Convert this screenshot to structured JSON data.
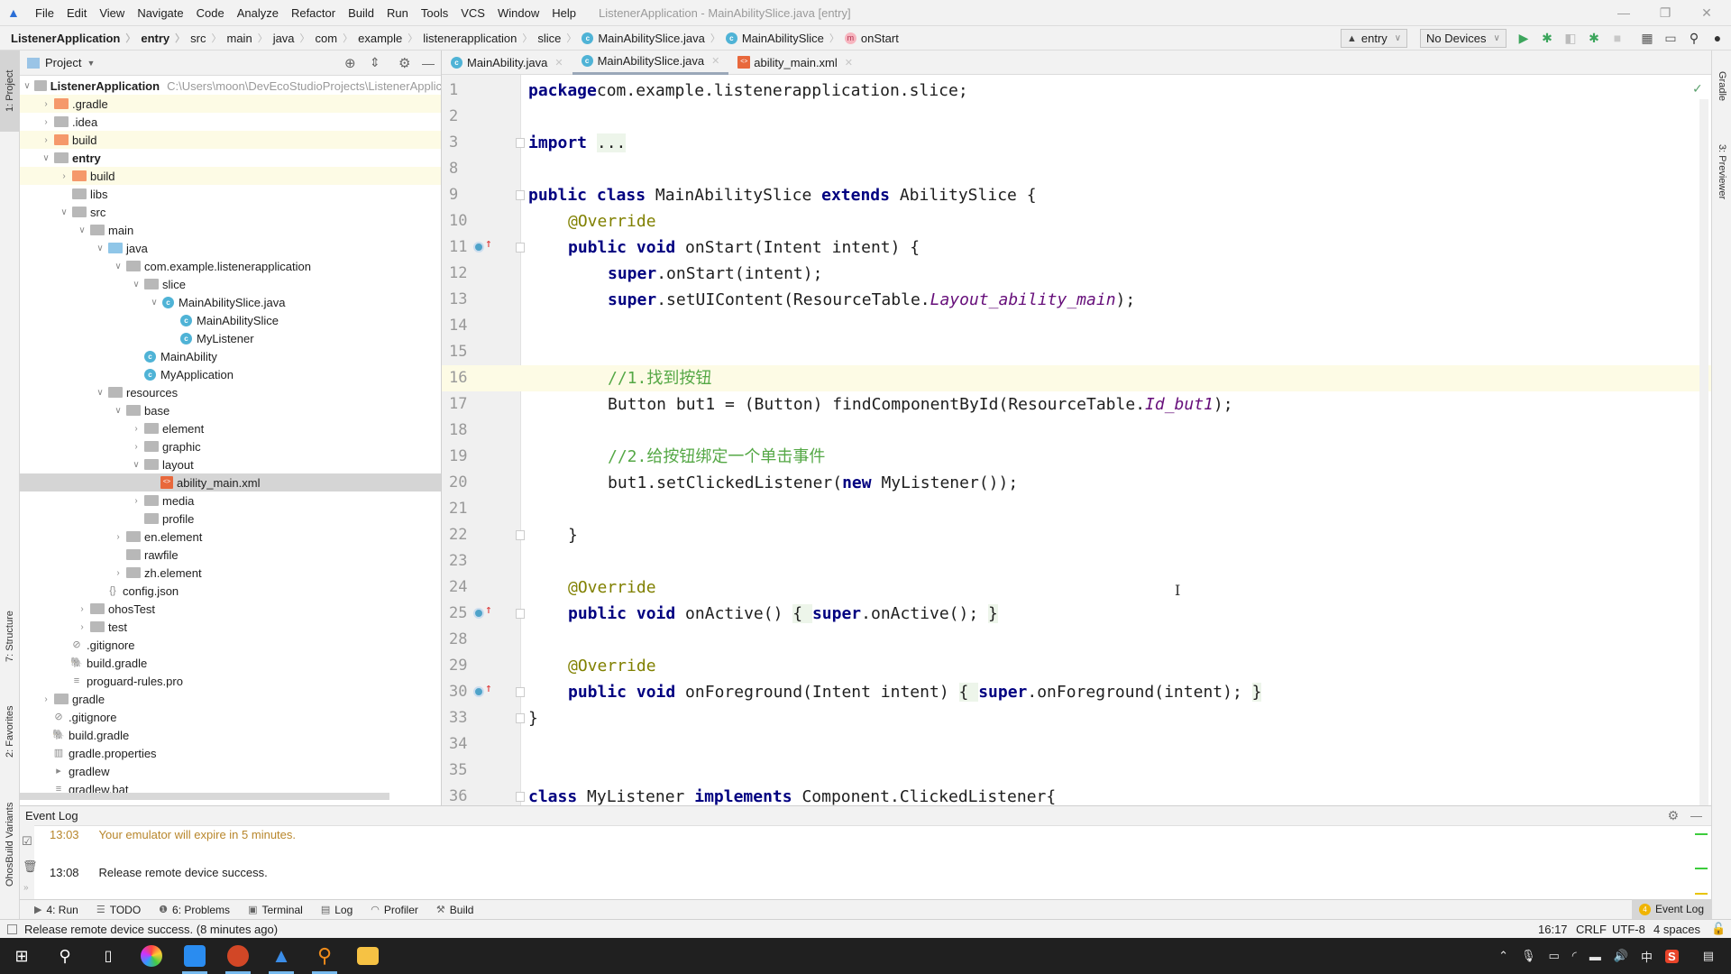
{
  "menubar": {
    "items": [
      "File",
      "Edit",
      "View",
      "Navigate",
      "Code",
      "Analyze",
      "Refactor",
      "Build",
      "Run",
      "Tools",
      "VCS",
      "Window",
      "Help"
    ],
    "window_title": "ListenerApplication - MainAbilitySlice.java [entry]"
  },
  "navbar": {
    "breadcrumbs": [
      "ListenerApplication",
      "entry",
      "src",
      "main",
      "java",
      "com",
      "example",
      "listenerapplication",
      "slice",
      "MainAbilitySlice.java",
      "MainAbilitySlice",
      "onStart"
    ],
    "module_select": "entry",
    "device_select": "No Devices"
  },
  "left_stripe": {
    "tabs": [
      "1: Project",
      "7: Structure",
      "2: Favorites",
      "OhosBuild Variants"
    ]
  },
  "right_stripe": {
    "tabs": [
      "Gradle",
      "3: Previewer"
    ]
  },
  "project": {
    "title": "Project",
    "root": {
      "name": "ListenerApplication",
      "path": "C:\\Users\\moon\\DevEcoStudioProjects\\ListenerApplic"
    },
    "rows": [
      {
        "label": ".gradle",
        "depth": 1,
        "arrow": "right",
        "icon": "folder-orange",
        "hl": true
      },
      {
        "label": ".idea",
        "depth": 1,
        "arrow": "right",
        "icon": "folder-gray"
      },
      {
        "label": "build",
        "depth": 1,
        "arrow": "right",
        "icon": "folder-orange",
        "hl": true
      },
      {
        "label": "entry",
        "depth": 1,
        "arrow": "down",
        "icon": "folder-module",
        "bold": true
      },
      {
        "label": "build",
        "depth": 2,
        "arrow": "right",
        "icon": "folder-orange",
        "hl": true
      },
      {
        "label": "libs",
        "depth": 2,
        "arrow": "",
        "icon": "folder-gray"
      },
      {
        "label": "src",
        "depth": 2,
        "arrow": "down",
        "icon": "folder-gray"
      },
      {
        "label": "main",
        "depth": 3,
        "arrow": "down",
        "icon": "folder-gray"
      },
      {
        "label": "java",
        "depth": 4,
        "arrow": "down",
        "icon": "folder-blue"
      },
      {
        "label": "com.example.listenerapplication",
        "depth": 5,
        "arrow": "down",
        "icon": "folder-gray"
      },
      {
        "label": "slice",
        "depth": 6,
        "arrow": "down",
        "icon": "folder-gray"
      },
      {
        "label": "MainAbilitySlice.java",
        "depth": 7,
        "arrow": "down",
        "icon": "class"
      },
      {
        "label": "MainAbilitySlice",
        "depth": 8,
        "arrow": "",
        "icon": "class"
      },
      {
        "label": "MyListener",
        "depth": 8,
        "arrow": "",
        "icon": "class"
      },
      {
        "label": "MainAbility",
        "depth": 6,
        "arrow": "",
        "icon": "class"
      },
      {
        "label": "MyApplication",
        "depth": 6,
        "arrow": "",
        "icon": "class"
      },
      {
        "label": "resources",
        "depth": 4,
        "arrow": "down",
        "icon": "folder-res"
      },
      {
        "label": "base",
        "depth": 5,
        "arrow": "down",
        "icon": "folder-gray"
      },
      {
        "label": "element",
        "depth": 6,
        "arrow": "right",
        "icon": "folder-gray"
      },
      {
        "label": "graphic",
        "depth": 6,
        "arrow": "right",
        "icon": "folder-gray"
      },
      {
        "label": "layout",
        "depth": 6,
        "arrow": "down",
        "icon": "folder-gray"
      },
      {
        "label": "ability_main.xml",
        "depth": 7,
        "arrow": "",
        "icon": "xml",
        "sel": true
      },
      {
        "label": "media",
        "depth": 6,
        "arrow": "right",
        "icon": "folder-gray"
      },
      {
        "label": "profile",
        "depth": 6,
        "arrow": "",
        "icon": "folder-gray"
      },
      {
        "label": "en.element",
        "depth": 5,
        "arrow": "right",
        "icon": "folder-gray"
      },
      {
        "label": "rawfile",
        "depth": 5,
        "arrow": "",
        "icon": "folder-gray"
      },
      {
        "label": "zh.element",
        "depth": 5,
        "arrow": "right",
        "icon": "folder-gray"
      },
      {
        "label": "config.json",
        "depth": 4,
        "arrow": "",
        "icon": "json"
      },
      {
        "label": "ohosTest",
        "depth": 3,
        "arrow": "right",
        "icon": "folder-gray"
      },
      {
        "label": "test",
        "depth": 3,
        "arrow": "right",
        "icon": "folder-gray"
      },
      {
        "label": ".gitignore",
        "depth": 2,
        "arrow": "",
        "icon": "gitignore"
      },
      {
        "label": "build.gradle",
        "depth": 2,
        "arrow": "",
        "icon": "gradle"
      },
      {
        "label": "proguard-rules.pro",
        "depth": 2,
        "arrow": "",
        "icon": "text"
      },
      {
        "label": "gradle",
        "depth": 1,
        "arrow": "right",
        "icon": "folder-gray"
      },
      {
        "label": ".gitignore",
        "depth": 1,
        "arrow": "",
        "icon": "gitignore"
      },
      {
        "label": "build.gradle",
        "depth": 1,
        "arrow": "",
        "icon": "gradle"
      },
      {
        "label": "gradle.properties",
        "depth": 1,
        "arrow": "",
        "icon": "properties"
      },
      {
        "label": "gradlew",
        "depth": 1,
        "arrow": "",
        "icon": "exec"
      },
      {
        "label": "gradlew.bat",
        "depth": 1,
        "arrow": "",
        "icon": "text"
      }
    ]
  },
  "editor": {
    "tabs": [
      {
        "label": "MainAbility.java",
        "icon": "class"
      },
      {
        "label": "MainAbilitySlice.java",
        "icon": "class",
        "active": true
      },
      {
        "label": "ability_main.xml",
        "icon": "xml"
      }
    ],
    "current_line": 16,
    "lines": [
      {
        "n": "1",
        "indent": 0,
        "tokens": [
          [
            "kw",
            "package"
          ],
          [
            "",
            "com.example.listenerapplication.slice;"
          ]
        ]
      },
      {
        "n": "2",
        "indent": 0,
        "tokens": []
      },
      {
        "n": "3",
        "indent": 0,
        "fold": true,
        "tokens": [
          [
            "kw",
            "import"
          ],
          [
            "",
            " "
          ],
          [
            "fb",
            "..."
          ]
        ]
      },
      {
        "n": "8",
        "indent": 0,
        "tokens": []
      },
      {
        "n": "9",
        "indent": 0,
        "fold": true,
        "tokens": [
          [
            "kw",
            "public class"
          ],
          [
            "",
            " MainAbilitySlice "
          ],
          [
            "kw",
            "extends"
          ],
          [
            "",
            " AbilitySlice {"
          ]
        ]
      },
      {
        "n": "10",
        "indent": 1,
        "tokens": [
          [
            "an",
            "@Override"
          ]
        ]
      },
      {
        "n": "11",
        "indent": 1,
        "override": true,
        "fold": true,
        "tokens": [
          [
            "kw",
            "public void"
          ],
          [
            "",
            " onStart(Intent intent) {"
          ]
        ]
      },
      {
        "n": "12",
        "indent": 2,
        "tokens": [
          [
            "kw",
            "super"
          ],
          [
            "",
            ".onStart(intent);"
          ]
        ]
      },
      {
        "n": "13",
        "indent": 2,
        "tokens": [
          [
            "kw",
            "super"
          ],
          [
            "",
            ".setUIContent(ResourceTable."
          ],
          [
            "it",
            "Layout_ability_main"
          ],
          [
            "",
            ");"
          ]
        ]
      },
      {
        "n": "14",
        "indent": 0,
        "tokens": []
      },
      {
        "n": "15",
        "indent": 0,
        "tokens": []
      },
      {
        "n": "16",
        "indent": 2,
        "tokens": [
          [
            "cm",
            "//1.找到按钮"
          ]
        ]
      },
      {
        "n": "17",
        "indent": 2,
        "tokens": [
          [
            "",
            "Button but1 = (Button) findComponentById(ResourceTable."
          ],
          [
            "it",
            "Id_but1"
          ],
          [
            "",
            ");"
          ]
        ]
      },
      {
        "n": "18",
        "indent": 0,
        "tokens": []
      },
      {
        "n": "19",
        "indent": 2,
        "tokens": [
          [
            "cm",
            "//2.给按钮绑定一个单击事件"
          ]
        ]
      },
      {
        "n": "20",
        "indent": 2,
        "tokens": [
          [
            "",
            "but1.setClickedListener("
          ],
          [
            "kw",
            "new"
          ],
          [
            "",
            " MyListener());"
          ]
        ]
      },
      {
        "n": "21",
        "indent": 0,
        "tokens": []
      },
      {
        "n": "22",
        "indent": 1,
        "fold": true,
        "tokens": [
          [
            "",
            "}"
          ]
        ]
      },
      {
        "n": "23",
        "indent": 0,
        "tokens": []
      },
      {
        "n": "24",
        "indent": 1,
        "tokens": [
          [
            "an",
            "@Override"
          ]
        ]
      },
      {
        "n": "25",
        "indent": 1,
        "override": true,
        "fold": true,
        "tokens": [
          [
            "kw",
            "public void"
          ],
          [
            "",
            " onActive() "
          ],
          [
            "fb",
            "{ "
          ],
          [
            "kw",
            "super"
          ],
          [
            "",
            ".onActive(); "
          ],
          [
            "fb",
            "}"
          ]
        ]
      },
      {
        "n": "28",
        "indent": 0,
        "tokens": []
      },
      {
        "n": "29",
        "indent": 1,
        "tokens": [
          [
            "an",
            "@Override"
          ]
        ]
      },
      {
        "n": "30",
        "indent": 1,
        "override": true,
        "fold": true,
        "tokens": [
          [
            "kw",
            "public void"
          ],
          [
            "",
            " onForeground(Intent intent) "
          ],
          [
            "fb",
            "{ "
          ],
          [
            "kw",
            "super"
          ],
          [
            "",
            ".onForeground(intent); "
          ],
          [
            "fb",
            "}"
          ]
        ]
      },
      {
        "n": "33",
        "indent": 0,
        "fold": true,
        "tokens": [
          [
            "",
            "}"
          ]
        ]
      },
      {
        "n": "34",
        "indent": 0,
        "tokens": []
      },
      {
        "n": "35",
        "indent": 0,
        "tokens": []
      },
      {
        "n": "36",
        "indent": 0,
        "fold": true,
        "tokens": [
          [
            "kw",
            "class"
          ],
          [
            "",
            " MyListener "
          ],
          [
            "kw",
            "implements"
          ],
          [
            "",
            " Component.ClickedListener{"
          ]
        ]
      }
    ]
  },
  "event_log": {
    "title": "Event Log",
    "entries": [
      {
        "time": "13:03",
        "message": "Your emulator will expire in 5 minutes.",
        "warn": true
      },
      {
        "time": "13:08",
        "message": "Release remote device success."
      }
    ]
  },
  "tool_tabs": [
    {
      "label": "4: Run",
      "icon": "▶"
    },
    {
      "label": "TODO",
      "icon": "☰"
    },
    {
      "label": "6: Problems",
      "icon": "❶"
    },
    {
      "label": "Terminal",
      "icon": "▣"
    },
    {
      "label": "Log",
      "icon": "▤"
    },
    {
      "label": "Profiler",
      "icon": "◠"
    },
    {
      "label": "Build",
      "icon": "⚒"
    }
  ],
  "event_log_tab": {
    "label": "Event Log",
    "badge": "4"
  },
  "status": {
    "message": "Release remote device success. (8 minutes ago)",
    "position": "16:17",
    "line_sep": "CRLF",
    "encoding": "UTF-8",
    "indent": "4 spaces"
  },
  "tray": {
    "ime": "中"
  },
  "colors": {
    "keyword": "#000080",
    "annotation": "#808000",
    "comment": "#55a846",
    "field": "#660e7a",
    "warn": "#b8862b"
  }
}
